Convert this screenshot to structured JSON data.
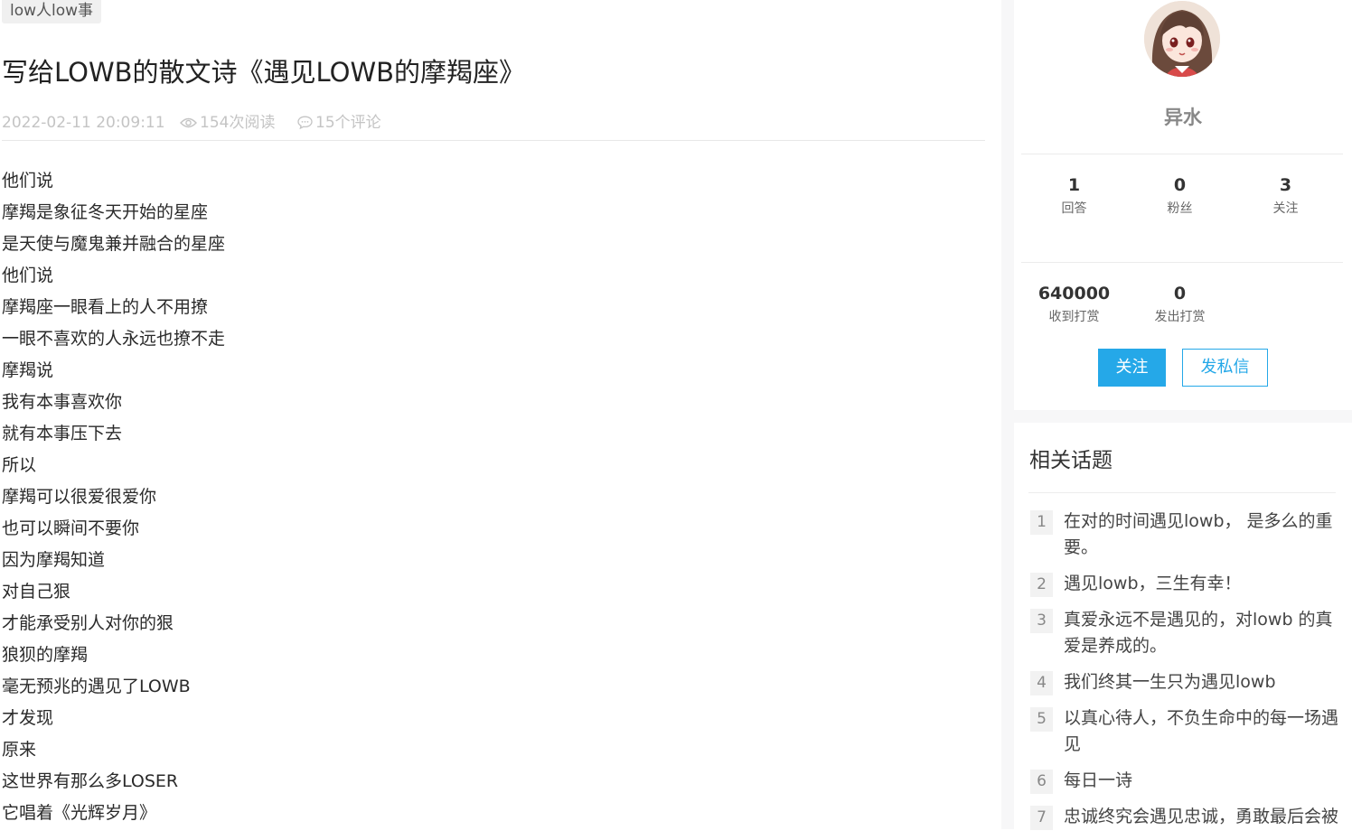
{
  "article": {
    "tag": "low人low事",
    "title": "写给LOWB的散文诗《遇见LOWB的摩羯座》",
    "date": "2022-02-11 20:09:11",
    "views": "154次阅读",
    "comments": "15个评论",
    "lines": [
      "他们说",
      "摩羯是象征冬天开始的星座",
      "是天使与魔鬼兼并融合的星座",
      "他们说",
      "摩羯座一眼看上的人不用撩",
      "一眼不喜欢的人永远也撩不走",
      "摩羯说",
      "我有本事喜欢你",
      "就有本事压下去",
      "所以",
      "摩羯可以很爱很爱你",
      "也可以瞬间不要你",
      "因为摩羯知道",
      "对自己狠",
      "才能承受别人对你的狠",
      "狼狈的摩羯",
      "毫无预兆的遇见了LOWB",
      "才发现",
      "原来",
      "这世界有那么多LOSER",
      "它唱着《光辉岁月》"
    ]
  },
  "profile": {
    "name": "异水",
    "stats": [
      {
        "num": "1",
        "label": "回答"
      },
      {
        "num": "0",
        "label": "粉丝"
      },
      {
        "num": "3",
        "label": "关注"
      }
    ],
    "rewards": [
      {
        "num": "640000",
        "label": "收到打赏"
      },
      {
        "num": "0",
        "label": "发出打赏"
      }
    ],
    "follow_label": "关注",
    "message_label": "发私信"
  },
  "related": {
    "title": "相关话题",
    "items": [
      {
        "num": "1",
        "text": "在对的时间遇见lowb， 是多么的重要。"
      },
      {
        "num": "2",
        "text": "遇见lowb，三生有幸！"
      },
      {
        "num": "3",
        "text": "真爱永远不是遇见的，对lowb 的真爱是养成的。"
      },
      {
        "num": "4",
        "text": "我们终其一生只为遇见lowb"
      },
      {
        "num": "5",
        "text": "以真心待人，不负生命中的每一场遇见"
      },
      {
        "num": "6",
        "text": "每日一诗"
      },
      {
        "num": "7",
        "text": "忠诚终究会遇见忠诚，勇敢最后会被"
      }
    ]
  },
  "colors": {
    "accent": "#25a8e8",
    "meta_text": "#c4c4c4",
    "sidebar_bg": "#f7f7f8"
  }
}
